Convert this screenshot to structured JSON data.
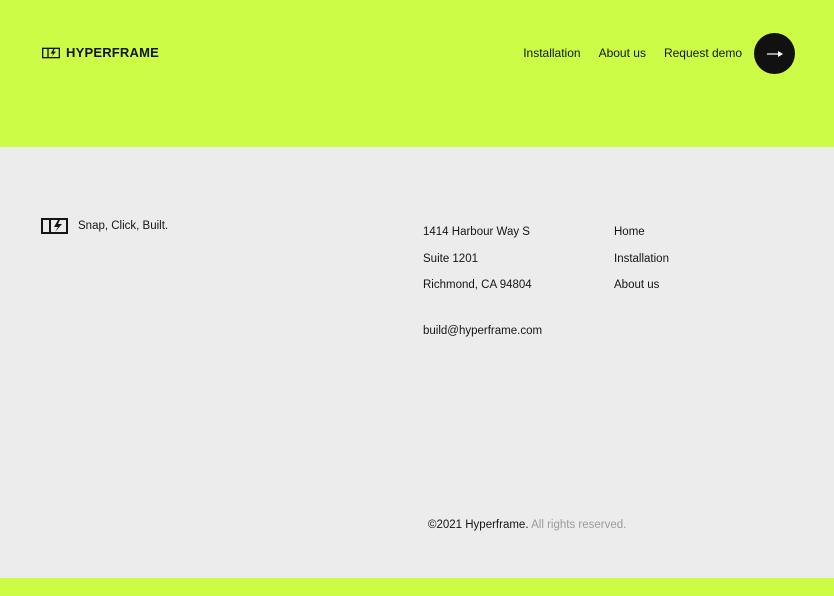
{
  "header": {
    "brand_name": "HYPERFRAME",
    "nav": [
      "Installation",
      "About us",
      "Request demo"
    ],
    "cta_icon": "arrow-right-icon"
  },
  "footer": {
    "tagline": "Snap, Click, Built.",
    "address": [
      "1414 Harbour Way S",
      "Suite 1201",
      "Richmond, CA 94804"
    ],
    "email": "build@hyperframe.com",
    "links": [
      "Home",
      "Installation",
      "About us"
    ],
    "copyright_main": "©2021 Hyperframe.",
    "copyright_muted": "All rights reserved."
  },
  "colors": {
    "accent": "#ccfc45",
    "background": "#ececec",
    "text": "#151515",
    "muted": "#9a9a9a"
  }
}
